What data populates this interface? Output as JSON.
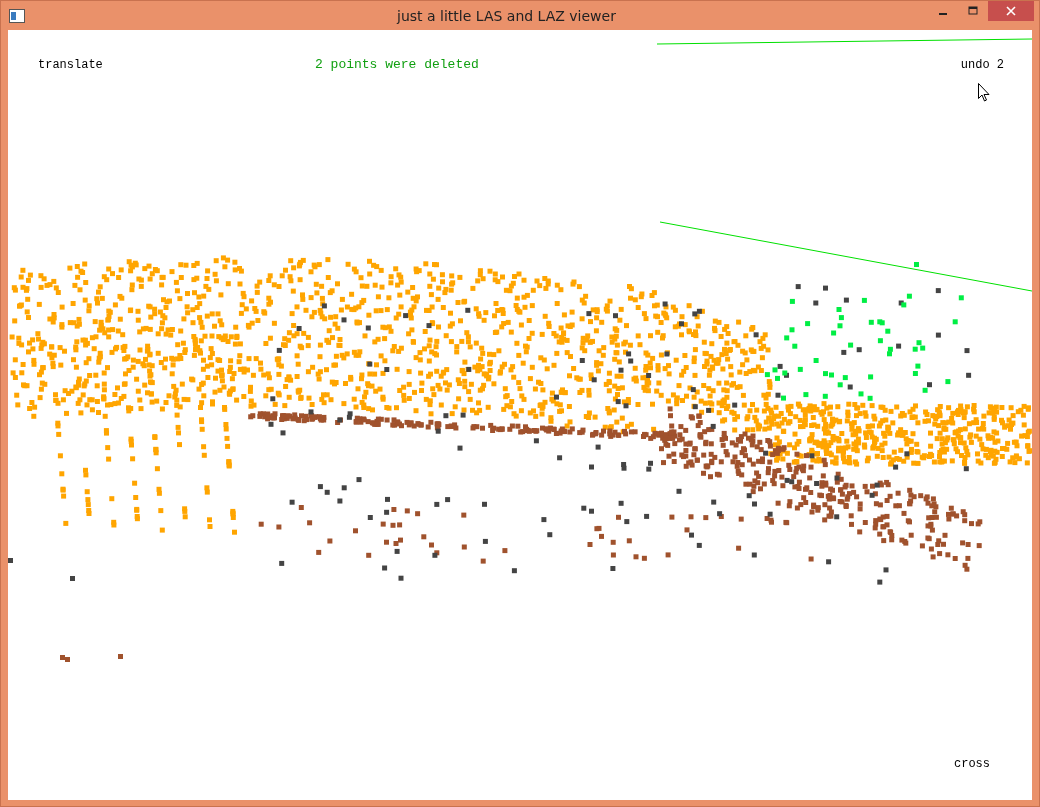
{
  "window": {
    "title": "just a little LAS and LAZ viewer"
  },
  "viewer": {
    "mode": "translate",
    "message": "2 points were deleted",
    "undo": "undo 2",
    "cursor_mode": "cross"
  }
}
